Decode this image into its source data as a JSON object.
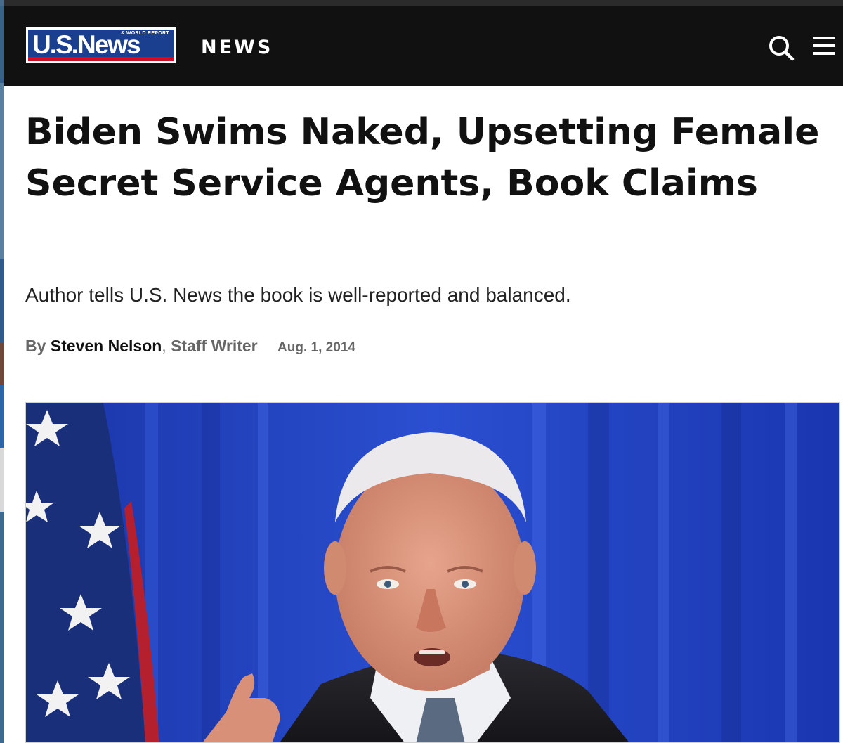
{
  "header": {
    "logo_text": "U.S.News",
    "logo_subtext": "& WORLD REPORT",
    "section_label": "NEWS",
    "search_icon": "search-icon",
    "menu_icon": "hamburger-menu-icon"
  },
  "article": {
    "headline": "Biden Swims Naked, Upsetting Female Secret Service Agents, Book Claims",
    "subheadline": "Author tells U.S. News the book is well-reported and balanced.",
    "byline": {
      "prefix": "By",
      "author": "Steven Nelson",
      "separator": ",",
      "role": "Staff Writer",
      "date": "Aug. 1, 2014"
    }
  },
  "colors": {
    "header_bg": "#111111",
    "logo_blue": "#1a3f8f",
    "logo_red": "#c8102e",
    "hero_blue": "#1f3fbf"
  }
}
